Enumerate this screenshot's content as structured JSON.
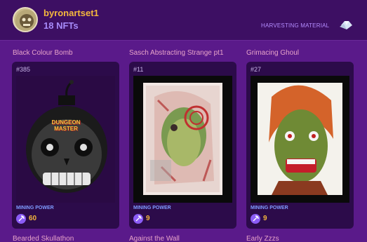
{
  "header": {
    "collection": "byronartset1",
    "count": "18 NFTs",
    "harvest_label": "HARVESTING MATERIAL"
  },
  "cards": [
    {
      "title": "Black Colour Bomb",
      "id": "#385",
      "mp_label": "MINING POWER",
      "mp_value": "60",
      "art_label": "DUNGEON MASTER"
    },
    {
      "title": "Sasch Abstracting Strange pt1",
      "id": "#11",
      "mp_label": "MINING POWER",
      "mp_value": "9"
    },
    {
      "title": "Grimacing Ghoul",
      "id": "#27",
      "mp_label": "MINING POWER",
      "mp_value": "9"
    }
  ],
  "next_row": [
    "Bearded Skullathon",
    "Against the Wall",
    "Early Zzzs"
  ]
}
